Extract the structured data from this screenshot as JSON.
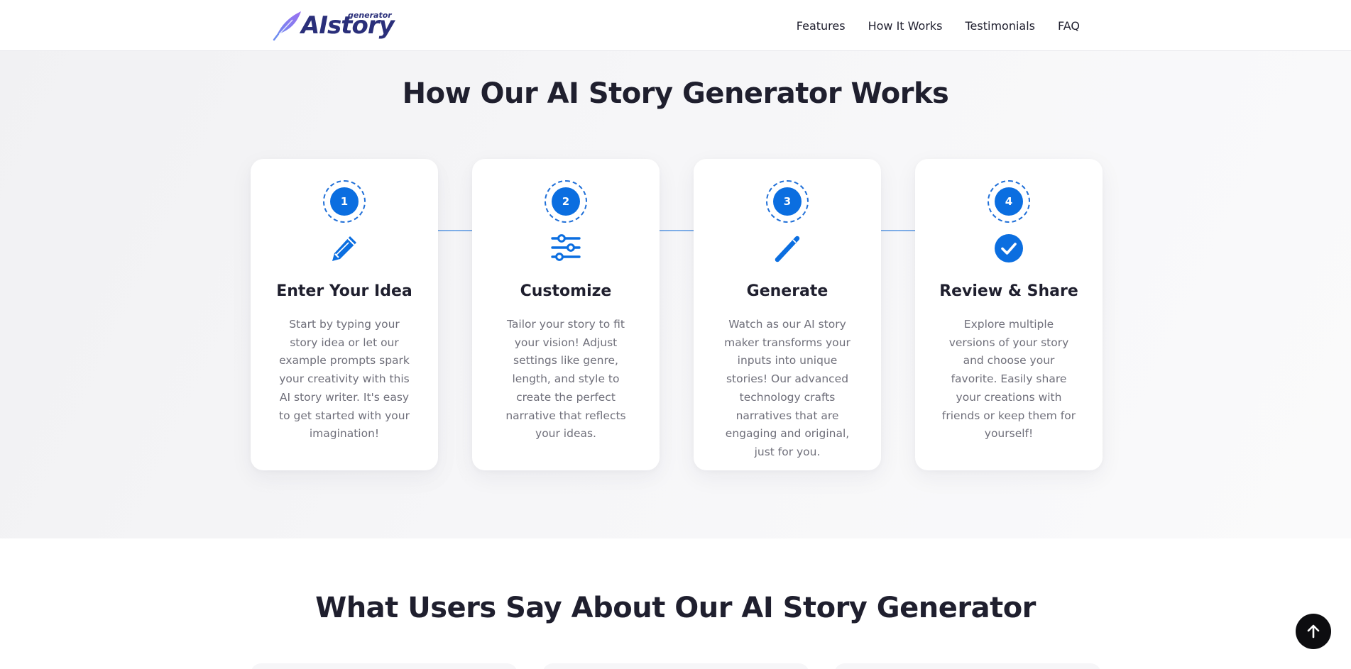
{
  "header": {
    "logo": {
      "wordmark": "AIstory",
      "tagline": "generator",
      "icon": "feather-icon"
    },
    "nav": [
      {
        "label": "Features"
      },
      {
        "label": "How It Works"
      },
      {
        "label": "Testimonials"
      },
      {
        "label": "FAQ"
      }
    ]
  },
  "how_it_works": {
    "title": "How Our AI Story Generator Works",
    "steps": [
      {
        "number": "1",
        "icon": "pencil-icon",
        "title": "Enter Your Idea",
        "text": "Start by typing your story idea or let our example prompts spark your creativity with this AI story writer. It's easy to get started with your imagination!"
      },
      {
        "number": "2",
        "icon": "sliders-icon",
        "title": "Customize",
        "text": "Tailor your story to fit your vision! Adjust settings like genre, length, and style to create the perfect narrative that reflects your ideas."
      },
      {
        "number": "3",
        "icon": "magic-wand-icon",
        "title": "Generate",
        "text": "Watch as our AI story maker transforms your inputs into unique stories! Our advanced technology crafts narratives that are engaging and original, just for you."
      },
      {
        "number": "4",
        "icon": "check-circle-icon",
        "title": "Review & Share",
        "text": "Explore multiple versions of your story and choose your favorite. Easily share your creations with friends or keep them for yourself!"
      }
    ]
  },
  "testimonials": {
    "title": "What Users Say About Our AI Story Generator"
  },
  "scroll_top": {
    "icon": "arrow-up-icon"
  },
  "colors": {
    "accent": "#0b6ee0",
    "logo": "#2a2f7a",
    "heading": "#1f1f2e",
    "body_text": "#6f6f7a",
    "section_bg": "#f4f4f6"
  }
}
